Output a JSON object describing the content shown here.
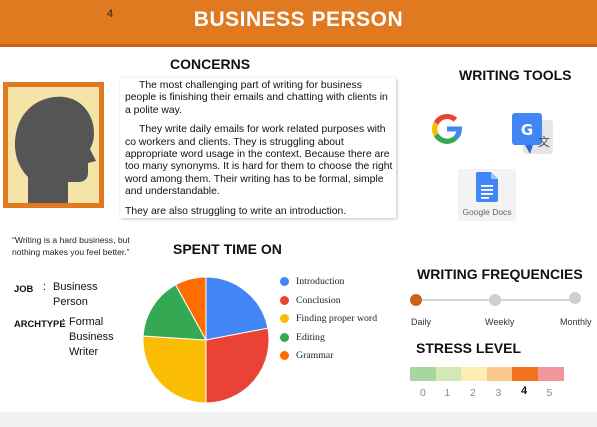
{
  "header": {
    "title": "BUSINESS PERSON",
    "page_number": "4"
  },
  "concerns": {
    "title": "CONCERNS",
    "paragraphs": [
      "The most challenging part of writing for business people is finishing their emails and chatting with clients in a polite way.",
      "They write daily emails for work related purposes with co workers and clients. They is struggling about appropriate word usage in the context. Because there are too many synonyms. It is hard for them to choose the right word among them. Their writing has to be  formal, simple and understandable.",
      "They are also struggling to write an introduction."
    ]
  },
  "quote": "“Writing is a hard business, but nothing makes you feel better.”",
  "profile": {
    "job_label": "JOB",
    "job_value": "Business Person",
    "archtype_label": "ARCHTYPE",
    "archtype_value": "Formal Business Writer"
  },
  "spent_time": {
    "title": "SPENT TIME ON",
    "legend": [
      "Introduction",
      "Conclusion",
      "Finding proper word",
      "Editing",
      "Grammar"
    ]
  },
  "chart_data": {
    "type": "pie",
    "categories": [
      "Introduction",
      "Conclusion",
      "Finding proper word",
      "Editing",
      "Grammar"
    ],
    "values": [
      22,
      28,
      26,
      16,
      8
    ],
    "colors": [
      "#4285f4",
      "#ea4335",
      "#fbbc04",
      "#34a853",
      "#ff6d01"
    ]
  },
  "tools": {
    "title": "WRITING TOOLS",
    "items": [
      {
        "icon": "google-icon"
      },
      {
        "icon": "google-translate-icon"
      },
      {
        "icon": "google-docs-icon",
        "label": "Google Docs"
      }
    ]
  },
  "frequency": {
    "title": "WRITING FREQUENCIES",
    "options": [
      "Daily",
      "Weekly",
      "Monthly"
    ],
    "selected": "Daily"
  },
  "stress": {
    "title": "STRESS LEVEL",
    "levels": [
      "0",
      "1",
      "2",
      "3",
      "4",
      "5"
    ],
    "selected": "4",
    "colors": [
      "#a8d5a2",
      "#d2e8b5",
      "#fbeeb0",
      "#fbc98a",
      "#f2731f",
      "#f2969a"
    ]
  }
}
